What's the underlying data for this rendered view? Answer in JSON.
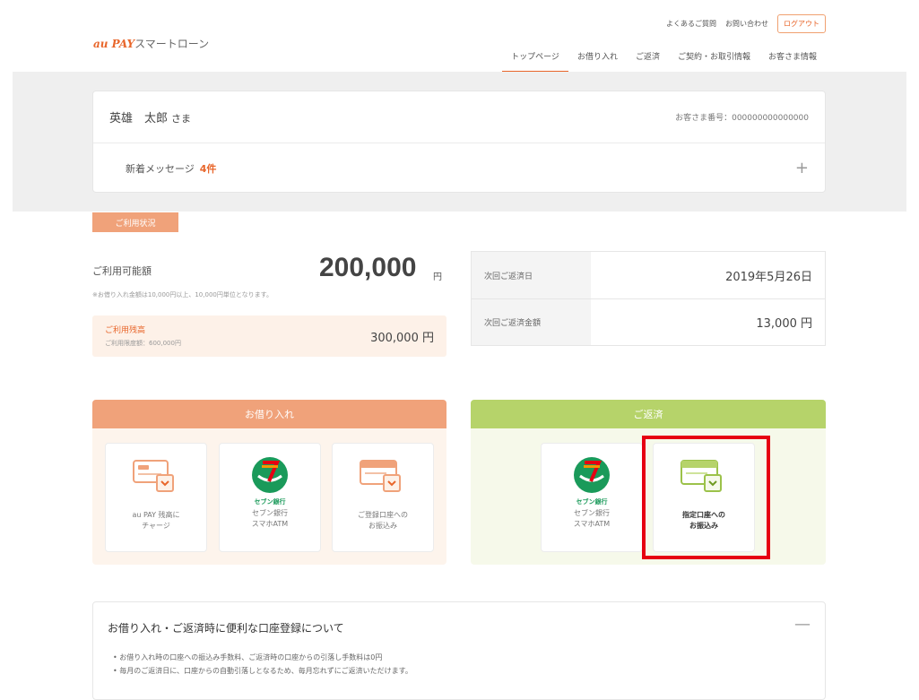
{
  "header": {
    "logo_brand": "au PAY",
    "logo_text": "スマートローン",
    "util_links": [
      "よくあるご質問",
      "お問い合わせ"
    ],
    "logout_label": "ログアウト",
    "nav": [
      "トップページ",
      "お借り入れ",
      "ご返済",
      "ご契約・お取引情報",
      "お客さま情報"
    ],
    "active_nav": "トップページ"
  },
  "customer": {
    "name": "英雄　太郎",
    "honorific": "さま",
    "number_label": "お客さま番号：",
    "number": "000000000000000",
    "messages_label": "新着メッセージ",
    "messages_count": "4件"
  },
  "status": {
    "tag": "ご利用状況",
    "available_label": "ご利用可能額",
    "available_amount": "200,000",
    "available_unit": "円",
    "note": "※お借り入れ金額は10,000円以上、10,000円単位となります。",
    "usage_title": "ご利用残高",
    "usage_limit": "ご利用限度額：600,000円",
    "usage_value": "300,000 円"
  },
  "repayment": {
    "rows": [
      {
        "label": "次回ご返済日",
        "value": "2019年5月26日"
      },
      {
        "label": "次回ご返済金額",
        "value": "13,000 円"
      }
    ]
  },
  "borrow_panel": {
    "title": "お借り入れ",
    "tiles": [
      {
        "label": "au PAY 残高に\nチャージ"
      },
      {
        "brand": "セブン銀行",
        "label": "セブン銀行\nスマホATM"
      },
      {
        "label": "ご登録口座への\nお振込み"
      }
    ]
  },
  "repay_panel": {
    "title": "ご返済",
    "tiles": [
      {
        "brand": "セブン銀行",
        "label": "セブン銀行\nスマホATM"
      },
      {
        "label": "指定口座への\nお振込み"
      }
    ]
  },
  "info": {
    "title": "お借り入れ・ご返済時に便利な口座登録について",
    "bullets": [
      "お借り入れ時の口座への振込み手数料、ご返済時の口座からの引落し手数料は0円",
      "毎月のご返済日に、口座からの自動引落しとなるため、毎月忘れずにご返済いただけます。"
    ]
  },
  "colors": {
    "accent_orange": "#e8662b",
    "borrow_header": "#f0a27a",
    "repay_header": "#b6d36a",
    "highlight": "#e60012",
    "seven_green": "#1a9a5a"
  }
}
